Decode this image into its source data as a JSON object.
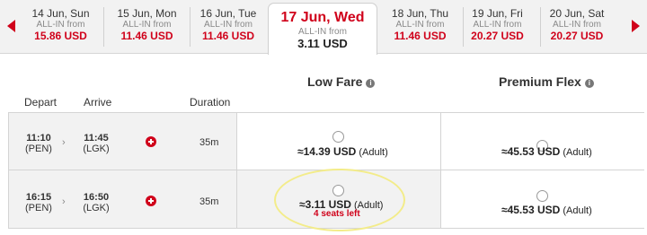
{
  "date_strip": {
    "tabs": [
      {
        "label": "14 Jun, Sun",
        "allin": "ALL-IN from",
        "price": "15.86 USD",
        "selected": false
      },
      {
        "label": "15 Jun, Mon",
        "allin": "ALL-IN from",
        "price": "11.46 USD",
        "selected": false
      },
      {
        "label": "16 Jun, Tue",
        "allin": "ALL-IN from",
        "price": "11.46 USD",
        "selected": false
      },
      {
        "label": "17 Jun, Wed",
        "allin": "ALL-IN from",
        "price": "3.11 USD",
        "selected": true
      },
      {
        "label": "18 Jun, Thu",
        "allin": "ALL-IN from",
        "price": "11.46 USD",
        "selected": false
      },
      {
        "label": "19 Jun, Fri",
        "allin": "ALL-IN from",
        "price": "20.27 USD",
        "selected": false
      },
      {
        "label": "20 Jun, Sat",
        "allin": "ALL-IN from",
        "price": "20.27 USD",
        "selected": false
      }
    ],
    "prev_icon": "triangle-left",
    "next_icon": "triangle-right"
  },
  "table": {
    "fare_headers": {
      "low": "Low Fare",
      "premium": "Premium Flex"
    },
    "info_glyph": "i",
    "columns": {
      "depart": "Depart",
      "arrive": "Arrive",
      "duration": "Duration"
    },
    "chevron": "›",
    "rows": [
      {
        "depart_time": "11:10",
        "depart_code": "(PEN)",
        "arrive_time": "11:45",
        "arrive_code": "(LGK)",
        "duration": "35m",
        "low_price": "≈14.39 USD",
        "low_pax": "(Adult)",
        "low_seats": "",
        "premium_price": "≈45.53 USD",
        "premium_pax": "(Adult)"
      },
      {
        "depart_time": "16:15",
        "depart_code": "(PEN)",
        "arrive_time": "16:50",
        "arrive_code": "(LGK)",
        "duration": "35m",
        "low_price": "≈3.11 USD",
        "low_pax": "(Adult)",
        "low_seats": "4 seats left",
        "premium_price": "≈45.53 USD",
        "premium_pax": "(Adult)"
      }
    ]
  },
  "colors": {
    "accent": "#d0021b",
    "background": "#f2f2f2",
    "highlight": "#f3ec8a"
  }
}
